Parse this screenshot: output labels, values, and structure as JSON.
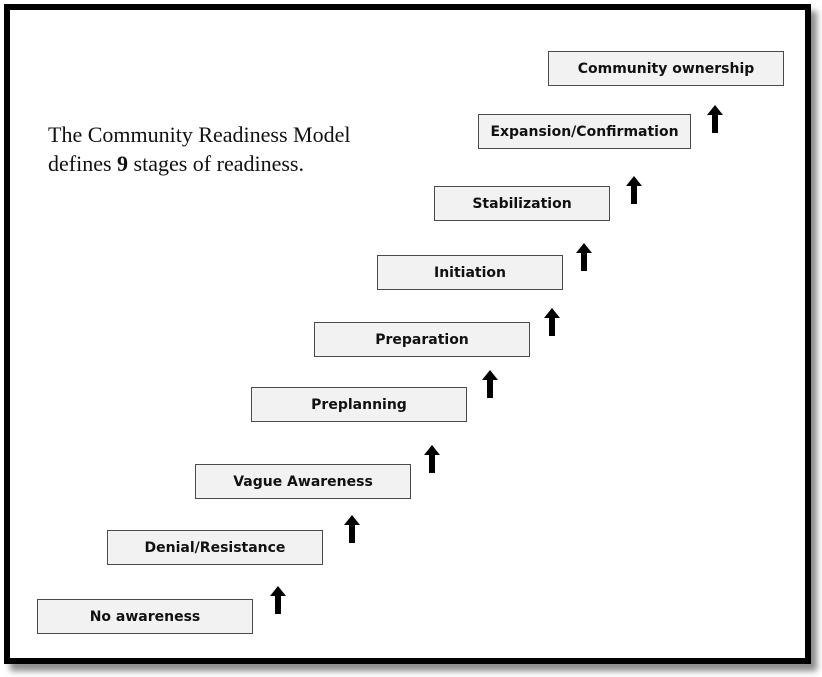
{
  "caption": {
    "line1": "The Community Readiness Model",
    "line2_prefix": "defines ",
    "line2_count": "9",
    "line2_suffix": " stages of readiness."
  },
  "stages": [
    {
      "order": 1,
      "label": "No awareness"
    },
    {
      "order": 2,
      "label": "Denial/Resistance"
    },
    {
      "order": 3,
      "label": "Vague Awareness"
    },
    {
      "order": 4,
      "label": "Preplanning"
    },
    {
      "order": 5,
      "label": "Preparation"
    },
    {
      "order": 6,
      "label": "Initiation"
    },
    {
      "order": 7,
      "label": "Stabilization"
    },
    {
      "order": 8,
      "label": "Expansion/Confirmation"
    },
    {
      "order": 9,
      "label": "Community ownership"
    }
  ],
  "arrow_icon": "up-arrow-icon",
  "colors": {
    "frame": "#000000",
    "box_fill": "#f2f2f2",
    "box_border": "#4a4a4a",
    "arrow": "#000000"
  }
}
